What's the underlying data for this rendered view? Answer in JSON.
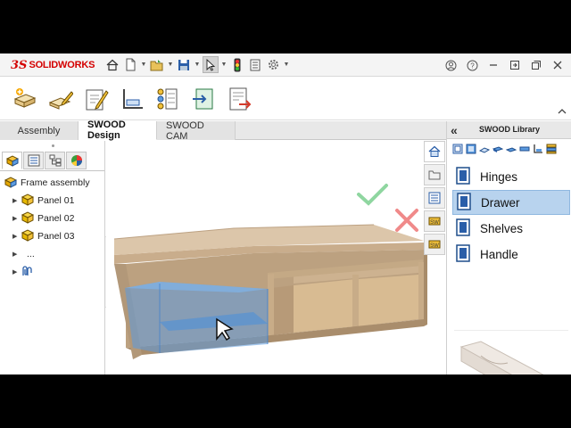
{
  "app": {
    "brand_mark": "3S",
    "brand_name": "SOLIDWORKS"
  },
  "tabs": [
    {
      "label": "Assembly",
      "active": false
    },
    {
      "label": "SWOOD Design",
      "active": true
    },
    {
      "label": "SWOOD CAM",
      "active": false
    }
  ],
  "tree": {
    "root": "Frame assembly",
    "children": [
      {
        "label": "Panel 01"
      },
      {
        "label": "Panel 02"
      },
      {
        "label": "Panel 03"
      }
    ],
    "more": "..."
  },
  "library": {
    "title": "SWOOD Library",
    "back": "«",
    "items": [
      {
        "label": "Hinges",
        "selected": false
      },
      {
        "label": "Drawer",
        "selected": true
      },
      {
        "label": "Shelves",
        "selected": false
      },
      {
        "label": "Handle",
        "selected": false
      }
    ]
  },
  "colors": {
    "accept": "#8fd6a0",
    "cancel": "#f08a8a",
    "selection": "#5b9be0",
    "wood": "#cfb596",
    "solidworks_red": "#d40000"
  }
}
